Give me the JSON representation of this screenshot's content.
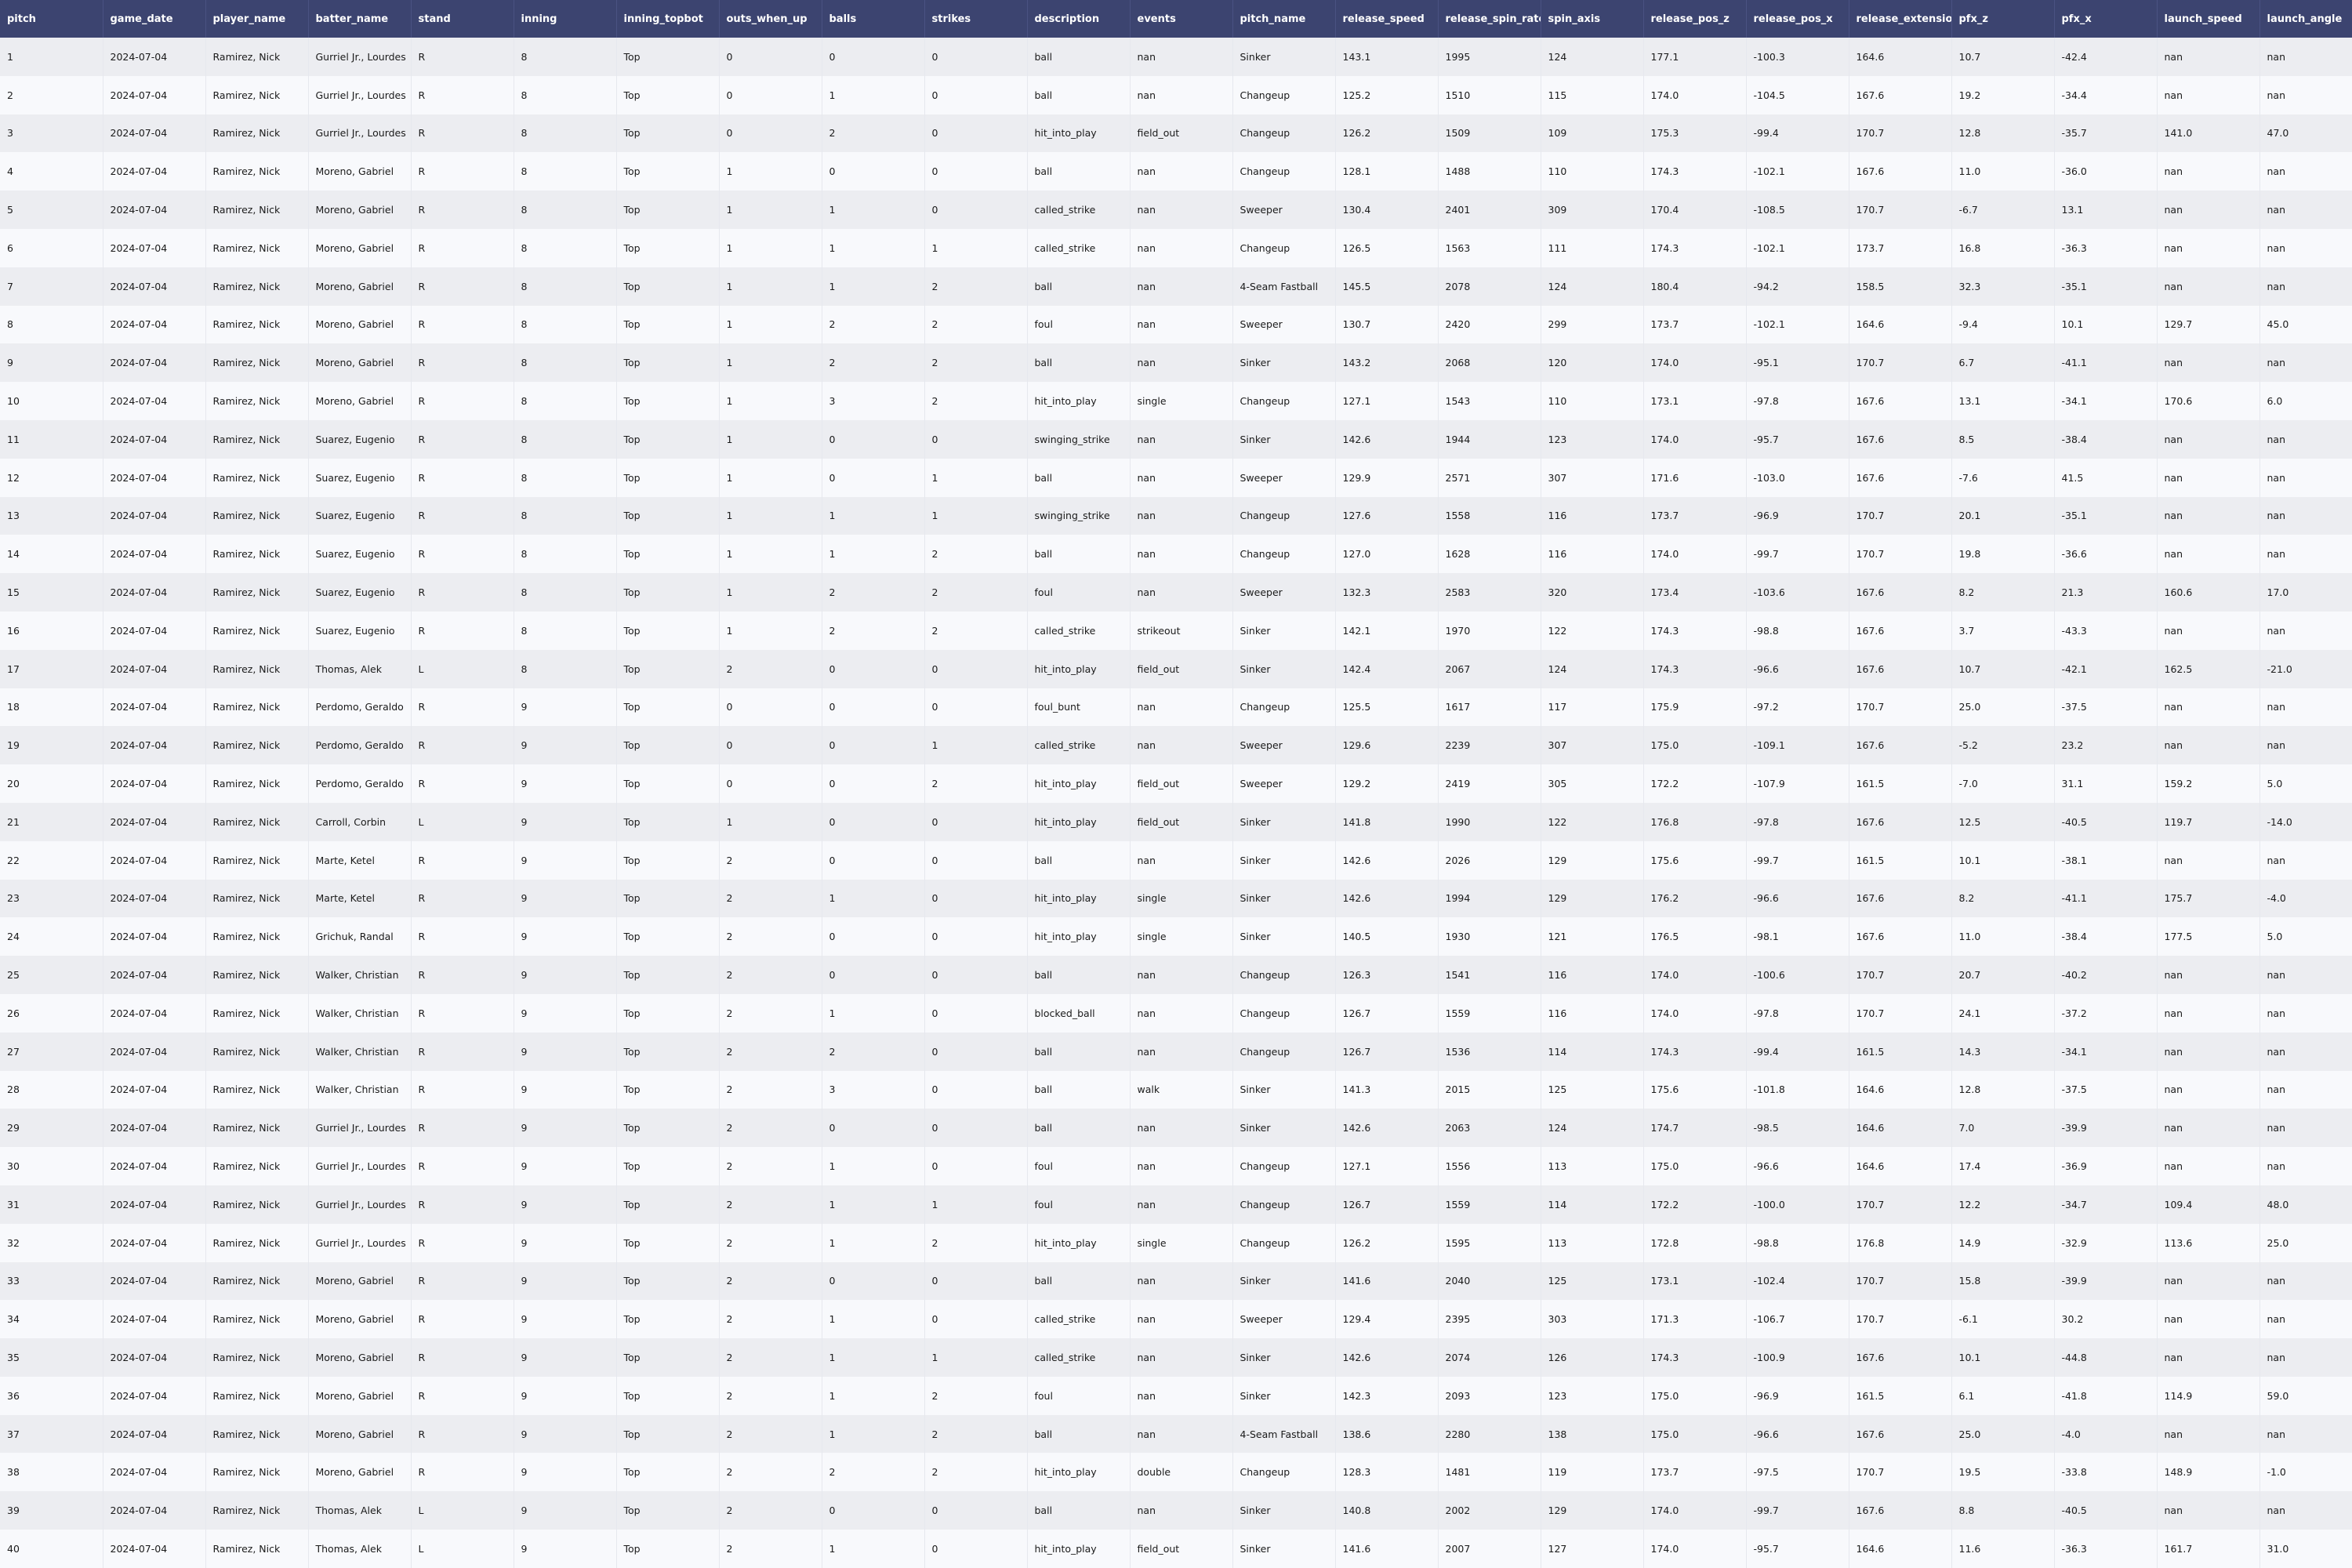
{
  "table": {
    "columns": [
      "pitch",
      "game_date",
      "player_name",
      "batter_name",
      "stand",
      "inning",
      "inning_topbot",
      "outs_when_up",
      "balls",
      "strikes",
      "description",
      "events",
      "pitch_name",
      "release_speed",
      "release_spin_rate",
      "spin_axis",
      "release_pos_z",
      "release_pos_x",
      "release_extension",
      "pfx_z",
      "pfx_x",
      "launch_speed",
      "launch_angle"
    ],
    "rows": [
      [
        "1",
        "2024-07-04",
        "Ramirez, Nick",
        "Gurriel Jr., Lourdes",
        "R",
        "8",
        "Top",
        "0",
        "0",
        "0",
        "ball",
        "nan",
        "Sinker",
        "143.1",
        "1995",
        "124",
        "177.1",
        "-100.3",
        "164.6",
        "10.7",
        "-42.4",
        "nan",
        "nan"
      ],
      [
        "2",
        "2024-07-04",
        "Ramirez, Nick",
        "Gurriel Jr., Lourdes",
        "R",
        "8",
        "Top",
        "0",
        "1",
        "0",
        "ball",
        "nan",
        "Changeup",
        "125.2",
        "1510",
        "115",
        "174.0",
        "-104.5",
        "167.6",
        "19.2",
        "-34.4",
        "nan",
        "nan"
      ],
      [
        "3",
        "2024-07-04",
        "Ramirez, Nick",
        "Gurriel Jr., Lourdes",
        "R",
        "8",
        "Top",
        "0",
        "2",
        "0",
        "hit_into_play",
        "field_out",
        "Changeup",
        "126.2",
        "1509",
        "109",
        "175.3",
        "-99.4",
        "170.7",
        "12.8",
        "-35.7",
        "141.0",
        "47.0"
      ],
      [
        "4",
        "2024-07-04",
        "Ramirez, Nick",
        "Moreno, Gabriel",
        "R",
        "8",
        "Top",
        "1",
        "0",
        "0",
        "ball",
        "nan",
        "Changeup",
        "128.1",
        "1488",
        "110",
        "174.3",
        "-102.1",
        "167.6",
        "11.0",
        "-36.0",
        "nan",
        "nan"
      ],
      [
        "5",
        "2024-07-04",
        "Ramirez, Nick",
        "Moreno, Gabriel",
        "R",
        "8",
        "Top",
        "1",
        "1",
        "0",
        "called_strike",
        "nan",
        "Sweeper",
        "130.4",
        "2401",
        "309",
        "170.4",
        "-108.5",
        "170.7",
        "-6.7",
        "13.1",
        "nan",
        "nan"
      ],
      [
        "6",
        "2024-07-04",
        "Ramirez, Nick",
        "Moreno, Gabriel",
        "R",
        "8",
        "Top",
        "1",
        "1",
        "1",
        "called_strike",
        "nan",
        "Changeup",
        "126.5",
        "1563",
        "111",
        "174.3",
        "-102.1",
        "173.7",
        "16.8",
        "-36.3",
        "nan",
        "nan"
      ],
      [
        "7",
        "2024-07-04",
        "Ramirez, Nick",
        "Moreno, Gabriel",
        "R",
        "8",
        "Top",
        "1",
        "1",
        "2",
        "ball",
        "nan",
        "4-Seam Fastball",
        "145.5",
        "2078",
        "124",
        "180.4",
        "-94.2",
        "158.5",
        "32.3",
        "-35.1",
        "nan",
        "nan"
      ],
      [
        "8",
        "2024-07-04",
        "Ramirez, Nick",
        "Moreno, Gabriel",
        "R",
        "8",
        "Top",
        "1",
        "2",
        "2",
        "foul",
        "nan",
        "Sweeper",
        "130.7",
        "2420",
        "299",
        "173.7",
        "-102.1",
        "164.6",
        "-9.4",
        "10.1",
        "129.7",
        "45.0"
      ],
      [
        "9",
        "2024-07-04",
        "Ramirez, Nick",
        "Moreno, Gabriel",
        "R",
        "8",
        "Top",
        "1",
        "2",
        "2",
        "ball",
        "nan",
        "Sinker",
        "143.2",
        "2068",
        "120",
        "174.0",
        "-95.1",
        "170.7",
        "6.7",
        "-41.1",
        "nan",
        "nan"
      ],
      [
        "10",
        "2024-07-04",
        "Ramirez, Nick",
        "Moreno, Gabriel",
        "R",
        "8",
        "Top",
        "1",
        "3",
        "2",
        "hit_into_play",
        "single",
        "Changeup",
        "127.1",
        "1543",
        "110",
        "173.1",
        "-97.8",
        "167.6",
        "13.1",
        "-34.1",
        "170.6",
        "6.0"
      ],
      [
        "11",
        "2024-07-04",
        "Ramirez, Nick",
        "Suarez, Eugenio",
        "R",
        "8",
        "Top",
        "1",
        "0",
        "0",
        "swinging_strike",
        "nan",
        "Sinker",
        "142.6",
        "1944",
        "123",
        "174.0",
        "-95.7",
        "167.6",
        "8.5",
        "-38.4",
        "nan",
        "nan"
      ],
      [
        "12",
        "2024-07-04",
        "Ramirez, Nick",
        "Suarez, Eugenio",
        "R",
        "8",
        "Top",
        "1",
        "0",
        "1",
        "ball",
        "nan",
        "Sweeper",
        "129.9",
        "2571",
        "307",
        "171.6",
        "-103.0",
        "167.6",
        "-7.6",
        "41.5",
        "nan",
        "nan"
      ],
      [
        "13",
        "2024-07-04",
        "Ramirez, Nick",
        "Suarez, Eugenio",
        "R",
        "8",
        "Top",
        "1",
        "1",
        "1",
        "swinging_strike",
        "nan",
        "Changeup",
        "127.6",
        "1558",
        "116",
        "173.7",
        "-96.9",
        "170.7",
        "20.1",
        "-35.1",
        "nan",
        "nan"
      ],
      [
        "14",
        "2024-07-04",
        "Ramirez, Nick",
        "Suarez, Eugenio",
        "R",
        "8",
        "Top",
        "1",
        "1",
        "2",
        "ball",
        "nan",
        "Changeup",
        "127.0",
        "1628",
        "116",
        "174.0",
        "-99.7",
        "170.7",
        "19.8",
        "-36.6",
        "nan",
        "nan"
      ],
      [
        "15",
        "2024-07-04",
        "Ramirez, Nick",
        "Suarez, Eugenio",
        "R",
        "8",
        "Top",
        "1",
        "2",
        "2",
        "foul",
        "nan",
        "Sweeper",
        "132.3",
        "2583",
        "320",
        "173.4",
        "-103.6",
        "167.6",
        "8.2",
        "21.3",
        "160.6",
        "17.0"
      ],
      [
        "16",
        "2024-07-04",
        "Ramirez, Nick",
        "Suarez, Eugenio",
        "R",
        "8",
        "Top",
        "1",
        "2",
        "2",
        "called_strike",
        "strikeout",
        "Sinker",
        "142.1",
        "1970",
        "122",
        "174.3",
        "-98.8",
        "167.6",
        "3.7",
        "-43.3",
        "nan",
        "nan"
      ],
      [
        "17",
        "2024-07-04",
        "Ramirez, Nick",
        "Thomas, Alek",
        "L",
        "8",
        "Top",
        "2",
        "0",
        "0",
        "hit_into_play",
        "field_out",
        "Sinker",
        "142.4",
        "2067",
        "124",
        "174.3",
        "-96.6",
        "167.6",
        "10.7",
        "-42.1",
        "162.5",
        "-21.0"
      ],
      [
        "18",
        "2024-07-04",
        "Ramirez, Nick",
        "Perdomo, Geraldo",
        "R",
        "9",
        "Top",
        "0",
        "0",
        "0",
        "foul_bunt",
        "nan",
        "Changeup",
        "125.5",
        "1617",
        "117",
        "175.9",
        "-97.2",
        "170.7",
        "25.0",
        "-37.5",
        "nan",
        "nan"
      ],
      [
        "19",
        "2024-07-04",
        "Ramirez, Nick",
        "Perdomo, Geraldo",
        "R",
        "9",
        "Top",
        "0",
        "0",
        "1",
        "called_strike",
        "nan",
        "Sweeper",
        "129.6",
        "2239",
        "307",
        "175.0",
        "-109.1",
        "167.6",
        "-5.2",
        "23.2",
        "nan",
        "nan"
      ],
      [
        "20",
        "2024-07-04",
        "Ramirez, Nick",
        "Perdomo, Geraldo",
        "R",
        "9",
        "Top",
        "0",
        "0",
        "2",
        "hit_into_play",
        "field_out",
        "Sweeper",
        "129.2",
        "2419",
        "305",
        "172.2",
        "-107.9",
        "161.5",
        "-7.0",
        "31.1",
        "159.2",
        "5.0"
      ],
      [
        "21",
        "2024-07-04",
        "Ramirez, Nick",
        "Carroll, Corbin",
        "L",
        "9",
        "Top",
        "1",
        "0",
        "0",
        "hit_into_play",
        "field_out",
        "Sinker",
        "141.8",
        "1990",
        "122",
        "176.8",
        "-97.8",
        "167.6",
        "12.5",
        "-40.5",
        "119.7",
        "-14.0"
      ],
      [
        "22",
        "2024-07-04",
        "Ramirez, Nick",
        "Marte, Ketel",
        "R",
        "9",
        "Top",
        "2",
        "0",
        "0",
        "ball",
        "nan",
        "Sinker",
        "142.6",
        "2026",
        "129",
        "175.6",
        "-99.7",
        "161.5",
        "10.1",
        "-38.1",
        "nan",
        "nan"
      ],
      [
        "23",
        "2024-07-04",
        "Ramirez, Nick",
        "Marte, Ketel",
        "R",
        "9",
        "Top",
        "2",
        "1",
        "0",
        "hit_into_play",
        "single",
        "Sinker",
        "142.6",
        "1994",
        "129",
        "176.2",
        "-96.6",
        "167.6",
        "8.2",
        "-41.1",
        "175.7",
        "-4.0"
      ],
      [
        "24",
        "2024-07-04",
        "Ramirez, Nick",
        "Grichuk, Randal",
        "R",
        "9",
        "Top",
        "2",
        "0",
        "0",
        "hit_into_play",
        "single",
        "Sinker",
        "140.5",
        "1930",
        "121",
        "176.5",
        "-98.1",
        "167.6",
        "11.0",
        "-38.4",
        "177.5",
        "5.0"
      ],
      [
        "25",
        "2024-07-04",
        "Ramirez, Nick",
        "Walker, Christian",
        "R",
        "9",
        "Top",
        "2",
        "0",
        "0",
        "ball",
        "nan",
        "Changeup",
        "126.3",
        "1541",
        "116",
        "174.0",
        "-100.6",
        "170.7",
        "20.7",
        "-40.2",
        "nan",
        "nan"
      ],
      [
        "26",
        "2024-07-04",
        "Ramirez, Nick",
        "Walker, Christian",
        "R",
        "9",
        "Top",
        "2",
        "1",
        "0",
        "blocked_ball",
        "nan",
        "Changeup",
        "126.7",
        "1559",
        "116",
        "174.0",
        "-97.8",
        "170.7",
        "24.1",
        "-37.2",
        "nan",
        "nan"
      ],
      [
        "27",
        "2024-07-04",
        "Ramirez, Nick",
        "Walker, Christian",
        "R",
        "9",
        "Top",
        "2",
        "2",
        "0",
        "ball",
        "nan",
        "Changeup",
        "126.7",
        "1536",
        "114",
        "174.3",
        "-99.4",
        "161.5",
        "14.3",
        "-34.1",
        "nan",
        "nan"
      ],
      [
        "28",
        "2024-07-04",
        "Ramirez, Nick",
        "Walker, Christian",
        "R",
        "9",
        "Top",
        "2",
        "3",
        "0",
        "ball",
        "walk",
        "Sinker",
        "141.3",
        "2015",
        "125",
        "175.6",
        "-101.8",
        "164.6",
        "12.8",
        "-37.5",
        "nan",
        "nan"
      ],
      [
        "29",
        "2024-07-04",
        "Ramirez, Nick",
        "Gurriel Jr., Lourdes",
        "R",
        "9",
        "Top",
        "2",
        "0",
        "0",
        "ball",
        "nan",
        "Sinker",
        "142.6",
        "2063",
        "124",
        "174.7",
        "-98.5",
        "164.6",
        "7.0",
        "-39.9",
        "nan",
        "nan"
      ],
      [
        "30",
        "2024-07-04",
        "Ramirez, Nick",
        "Gurriel Jr., Lourdes",
        "R",
        "9",
        "Top",
        "2",
        "1",
        "0",
        "foul",
        "nan",
        "Changeup",
        "127.1",
        "1556",
        "113",
        "175.0",
        "-96.6",
        "164.6",
        "17.4",
        "-36.9",
        "nan",
        "nan"
      ],
      [
        "31",
        "2024-07-04",
        "Ramirez, Nick",
        "Gurriel Jr., Lourdes",
        "R",
        "9",
        "Top",
        "2",
        "1",
        "1",
        "foul",
        "nan",
        "Changeup",
        "126.7",
        "1559",
        "114",
        "172.2",
        "-100.0",
        "170.7",
        "12.2",
        "-34.7",
        "109.4",
        "48.0"
      ],
      [
        "32",
        "2024-07-04",
        "Ramirez, Nick",
        "Gurriel Jr., Lourdes",
        "R",
        "9",
        "Top",
        "2",
        "1",
        "2",
        "hit_into_play",
        "single",
        "Changeup",
        "126.2",
        "1595",
        "113",
        "172.8",
        "-98.8",
        "176.8",
        "14.9",
        "-32.9",
        "113.6",
        "25.0"
      ],
      [
        "33",
        "2024-07-04",
        "Ramirez, Nick",
        "Moreno, Gabriel",
        "R",
        "9",
        "Top",
        "2",
        "0",
        "0",
        "ball",
        "nan",
        "Sinker",
        "141.6",
        "2040",
        "125",
        "173.1",
        "-102.4",
        "170.7",
        "15.8",
        "-39.9",
        "nan",
        "nan"
      ],
      [
        "34",
        "2024-07-04",
        "Ramirez, Nick",
        "Moreno, Gabriel",
        "R",
        "9",
        "Top",
        "2",
        "1",
        "0",
        "called_strike",
        "nan",
        "Sweeper",
        "129.4",
        "2395",
        "303",
        "171.3",
        "-106.7",
        "170.7",
        "-6.1",
        "30.2",
        "nan",
        "nan"
      ],
      [
        "35",
        "2024-07-04",
        "Ramirez, Nick",
        "Moreno, Gabriel",
        "R",
        "9",
        "Top",
        "2",
        "1",
        "1",
        "called_strike",
        "nan",
        "Sinker",
        "142.6",
        "2074",
        "126",
        "174.3",
        "-100.9",
        "167.6",
        "10.1",
        "-44.8",
        "nan",
        "nan"
      ],
      [
        "36",
        "2024-07-04",
        "Ramirez, Nick",
        "Moreno, Gabriel",
        "R",
        "9",
        "Top",
        "2",
        "1",
        "2",
        "foul",
        "nan",
        "Sinker",
        "142.3",
        "2093",
        "123",
        "175.0",
        "-96.9",
        "161.5",
        "6.1",
        "-41.8",
        "114.9",
        "59.0"
      ],
      [
        "37",
        "2024-07-04",
        "Ramirez, Nick",
        "Moreno, Gabriel",
        "R",
        "9",
        "Top",
        "2",
        "1",
        "2",
        "ball",
        "nan",
        "4-Seam Fastball",
        "138.6",
        "2280",
        "138",
        "175.0",
        "-96.6",
        "167.6",
        "25.0",
        "-4.0",
        "nan",
        "nan"
      ],
      [
        "38",
        "2024-07-04",
        "Ramirez, Nick",
        "Moreno, Gabriel",
        "R",
        "9",
        "Top",
        "2",
        "2",
        "2",
        "hit_into_play",
        "double",
        "Changeup",
        "128.3",
        "1481",
        "119",
        "173.7",
        "-97.5",
        "170.7",
        "19.5",
        "-33.8",
        "148.9",
        "-1.0"
      ],
      [
        "39",
        "2024-07-04",
        "Ramirez, Nick",
        "Thomas, Alek",
        "L",
        "9",
        "Top",
        "2",
        "0",
        "0",
        "ball",
        "nan",
        "Sinker",
        "140.8",
        "2002",
        "129",
        "174.0",
        "-99.7",
        "167.6",
        "8.8",
        "-40.5",
        "nan",
        "nan"
      ],
      [
        "40",
        "2024-07-04",
        "Ramirez, Nick",
        "Thomas, Alek",
        "L",
        "9",
        "Top",
        "2",
        "1",
        "0",
        "hit_into_play",
        "field_out",
        "Sinker",
        "141.6",
        "2007",
        "127",
        "174.0",
        "-95.7",
        "164.6",
        "11.6",
        "-36.3",
        "161.7",
        "31.0"
      ]
    ]
  }
}
